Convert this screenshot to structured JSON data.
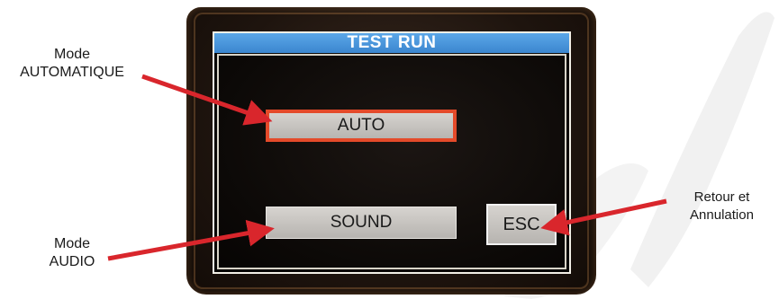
{
  "screen": {
    "title": "TEST RUN",
    "buttons": {
      "auto": "AUTO",
      "sound": "SOUND",
      "esc": "ESC"
    }
  },
  "annotations": {
    "auto": {
      "line1": "Mode",
      "line2": "AUTOMATIQUE"
    },
    "audio": {
      "line1": "Mode",
      "line2": "AUDIO"
    },
    "esc": {
      "line1": "Retour et",
      "line2": "Annulation"
    }
  },
  "colors": {
    "title_bar": "#3b86cf",
    "arrow": "#d9262c",
    "auto_border": "#e44a2a",
    "button_fill": "#c7c4c0"
  }
}
